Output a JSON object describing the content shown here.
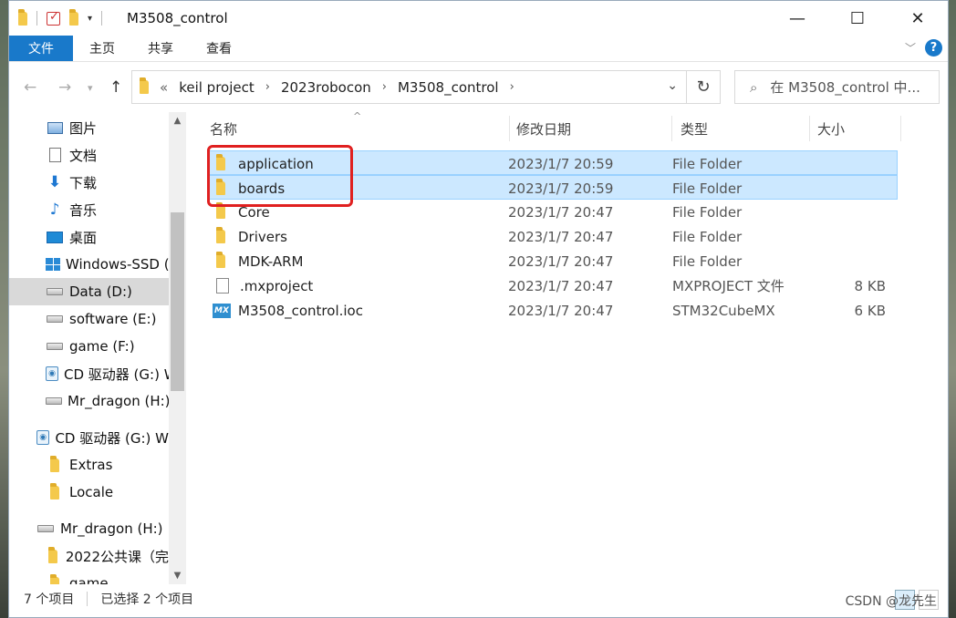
{
  "window": {
    "title": "M3508_control"
  },
  "ribbon": {
    "tabs": [
      "文件",
      "主页",
      "共享",
      "查看"
    ]
  },
  "address": {
    "breadcrumb": [
      "keil project",
      "2023robocon",
      "M3508_control"
    ],
    "overflow": "«",
    "search_placeholder": "在 M3508_control 中..."
  },
  "sidebar": {
    "items": [
      {
        "label": "图片",
        "icon": "picture-icon"
      },
      {
        "label": "文档",
        "icon": "document-icon"
      },
      {
        "label": "下载",
        "icon": "download-icon"
      },
      {
        "label": "音乐",
        "icon": "music-icon"
      },
      {
        "label": "桌面",
        "icon": "desktop-icon"
      },
      {
        "label": "Windows-SSD (",
        "icon": "windows-drive-icon"
      },
      {
        "label": "Data (D:)",
        "icon": "drive-icon",
        "selected": true
      },
      {
        "label": "software (E:)",
        "icon": "drive-icon"
      },
      {
        "label": "game (F:)",
        "icon": "drive-icon"
      },
      {
        "label": "CD 驱动器 (G:) W",
        "icon": "cd-drive-icon"
      },
      {
        "label": "Mr_dragon (H:)",
        "icon": "drive-icon"
      },
      {
        "label": "CD 驱动器 (G:) W",
        "icon": "cd-drive-icon"
      },
      {
        "label": "Extras",
        "icon": "folder-icon"
      },
      {
        "label": "Locale",
        "icon": "folder-icon"
      },
      {
        "label": "Mr_dragon (H:)",
        "icon": "drive-icon"
      },
      {
        "label": "2022公共课（完",
        "icon": "folder-icon"
      },
      {
        "label": "game",
        "icon": "folder-icon"
      }
    ]
  },
  "list": {
    "columns": [
      "名称",
      "修改日期",
      "类型",
      "大小"
    ],
    "rows": [
      {
        "name": "application",
        "date": "2023/1/7 20:59",
        "type": "File Folder",
        "size": "",
        "icon": "folder-icon",
        "selected": true
      },
      {
        "name": "boards",
        "date": "2023/1/7 20:59",
        "type": "File Folder",
        "size": "",
        "icon": "folder-icon",
        "selected": true
      },
      {
        "name": "Core",
        "date": "2023/1/7 20:47",
        "type": "File Folder",
        "size": "",
        "icon": "folder-icon"
      },
      {
        "name": "Drivers",
        "date": "2023/1/7 20:47",
        "type": "File Folder",
        "size": "",
        "icon": "folder-icon"
      },
      {
        "name": "MDK-ARM",
        "date": "2023/1/7 20:47",
        "type": "File Folder",
        "size": "",
        "icon": "folder-icon"
      },
      {
        "name": ".mxproject",
        "date": "2023/1/7 20:47",
        "type": "MXPROJECT 文件",
        "size": "8 KB",
        "icon": "file-icon"
      },
      {
        "name": "M3508_control.ioc",
        "date": "2023/1/7 20:47",
        "type": "STM32CubeMX",
        "size": "6 KB",
        "icon": "stm32cubemx-icon"
      }
    ]
  },
  "status": {
    "count": "7 个项目",
    "selected": "已选择 2 个项目"
  },
  "watermark": "CSDN @龙先生",
  "colors": {
    "accent": "#1979ca",
    "selection": "#cce8ff",
    "highlight": "#e02020"
  }
}
